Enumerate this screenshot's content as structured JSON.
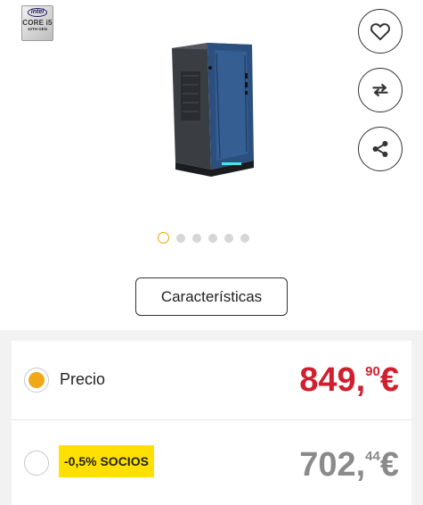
{
  "intel_badge": {
    "brand": "intel",
    "line": "CORE i5",
    "generation": "10TH GEN"
  },
  "product": {
    "image": "desktop-tower-pc"
  },
  "actions": {
    "favorite_icon": "heart-icon",
    "compare_icon": "swap-arrows-icon",
    "share_icon": "share-icon"
  },
  "carousel": {
    "total": 6,
    "active": 1
  },
  "characteristics_button": "Características",
  "prices": {
    "normal": {
      "label": "Precio",
      "integer": "849,",
      "decimals": "90",
      "currency": "€",
      "selected": true
    },
    "socios": {
      "label": "-0,5% SOCIOS",
      "integer": "702,",
      "decimals": "44",
      "currency": "€",
      "selected": false
    }
  },
  "colors": {
    "accent": "#f0a818",
    "price_red": "#d01f2e",
    "socios_badge": "#ffe000",
    "price_grey": "#8a8a8a"
  }
}
